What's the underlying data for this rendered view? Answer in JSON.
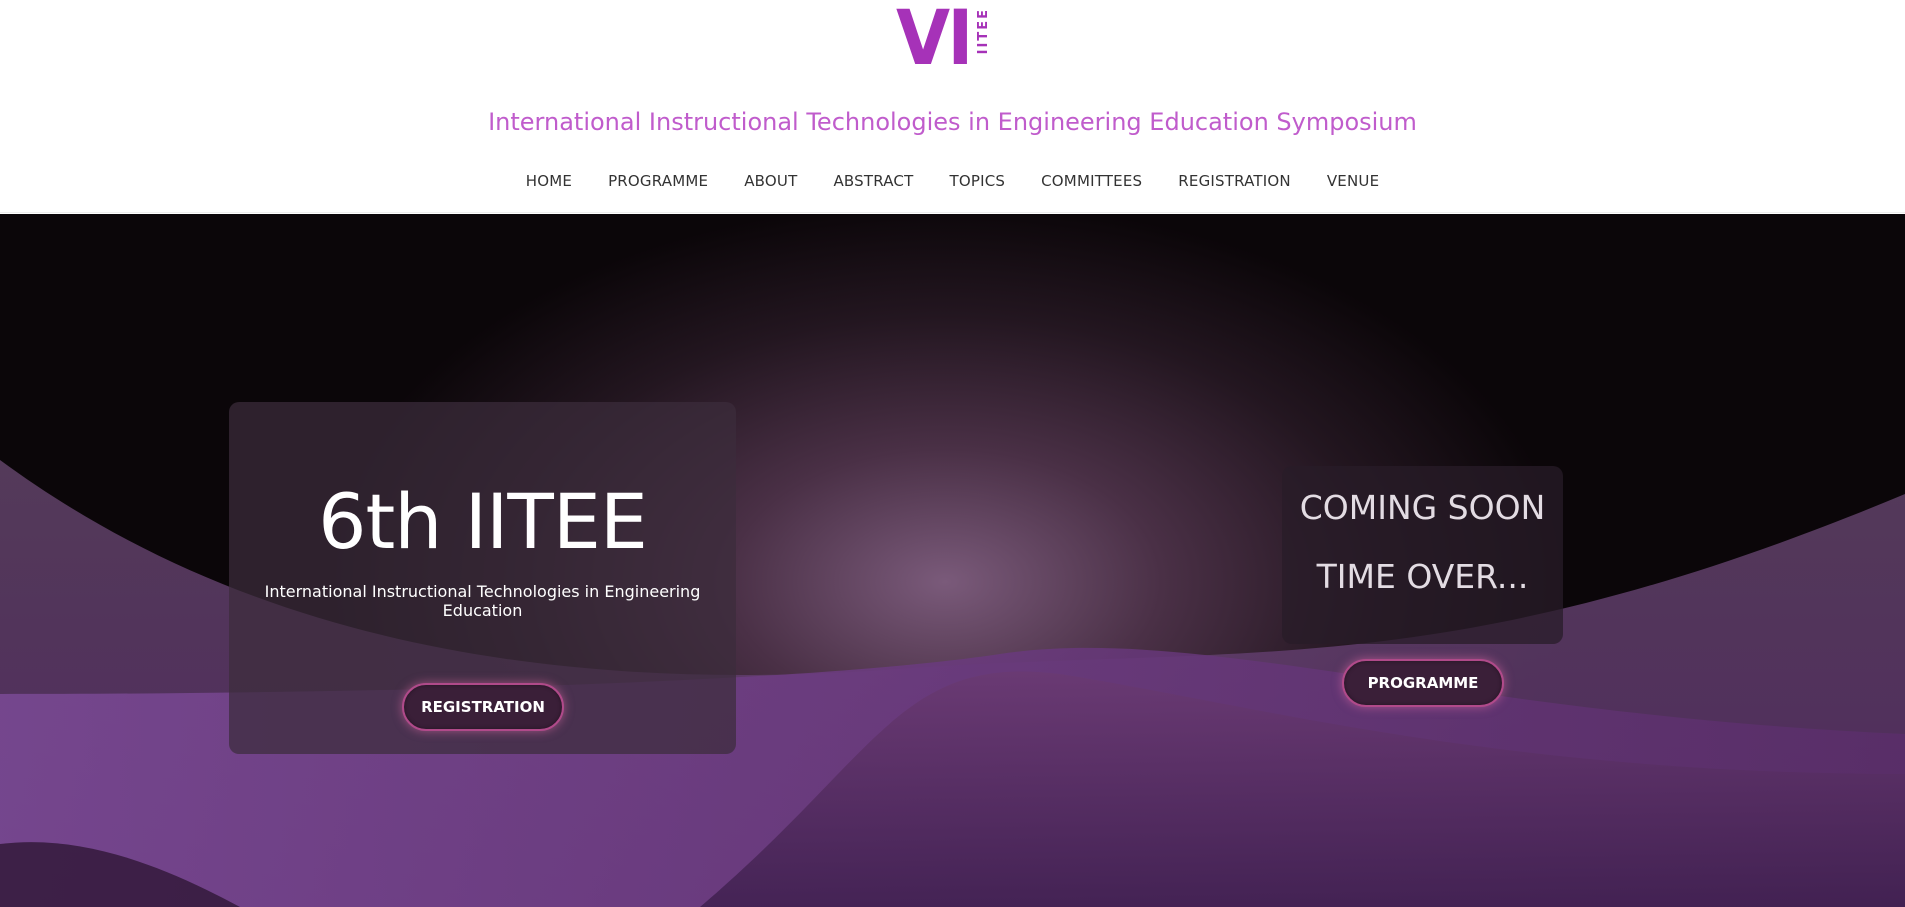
{
  "logo": {
    "mark": "VI",
    "sub": "IITEE"
  },
  "site": {
    "title": "International Instructional Technologies in Engineering Education Symposium"
  },
  "nav": {
    "items": [
      {
        "label": "HOME"
      },
      {
        "label": "PROGRAMME"
      },
      {
        "label": "ABOUT"
      },
      {
        "label": "ABSTRACT"
      },
      {
        "label": "TOPICS"
      },
      {
        "label": "COMMITTEES"
      },
      {
        "label": "REGISTRATION"
      },
      {
        "label": "VENUE"
      }
    ]
  },
  "hero": {
    "event_title": "6th IITEE",
    "event_subtitle": "International Instructional Technologies in Engineering Education",
    "registration_button": "REGISTRATION",
    "countdown": {
      "line1": "COMING SOON",
      "line2": "TIME OVER..."
    },
    "programme_button": "PROGRAMME"
  },
  "colors": {
    "brand_purple": "#a632b8",
    "title_pink": "#c05ccc",
    "wave_light": "#7a4a92",
    "wave_dark": "#4e2a5e"
  }
}
